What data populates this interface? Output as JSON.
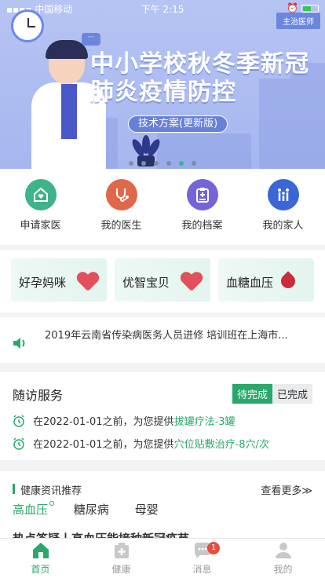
{
  "status_bar": {
    "carrier": "中国移动",
    "time": "下午 2:15"
  },
  "banner": {
    "role_badge": "主治医师",
    "title": "中小学校秋冬季新冠肺炎疫情防控",
    "button": "技术方案(更新版)",
    "dots_total": 6,
    "dots_active_index": 4
  },
  "quick_nav": [
    {
      "label": "申请家医",
      "icon": "home-heart-icon",
      "color": "#3fb389"
    },
    {
      "label": "我的医生",
      "icon": "stethoscope-icon",
      "color": "#e0674a"
    },
    {
      "label": "我的档案",
      "icon": "clipboard-icon",
      "color": "#7564d8"
    },
    {
      "label": "我的家人",
      "icon": "family-icon",
      "color": "#3a66d6"
    }
  ],
  "feature_cards": [
    {
      "label": "好孕妈咪",
      "icon": "heart-icon"
    },
    {
      "label": "优智宝贝",
      "icon": "heart-icon"
    },
    {
      "label": "血糖血压",
      "icon": "blood-drop-icon"
    }
  ],
  "notice": {
    "text": "2019年云南省传染病医务人员进修 培训班在上海市..."
  },
  "followup": {
    "title": "随访服务",
    "tabs": [
      "待完成",
      "已完成"
    ],
    "active_tab": 0,
    "items": [
      {
        "prefix": "在2022-01-01之前，为您提供",
        "highlight": "拔罐疗法-3罐"
      },
      {
        "prefix": "在2022-01-01之前，为您提供",
        "highlight": "穴位贴敷治疗-8穴/次"
      }
    ]
  },
  "news": {
    "title": "健康资讯推荐",
    "more": "查看更多≫",
    "tabs": [
      "高血压",
      "糖尿病",
      "母婴"
    ],
    "active_tab": 0,
    "article": "热点答疑丨高血压能接种新冠疫苗"
  },
  "tabbar": {
    "items": [
      "首页",
      "健康",
      "消息",
      "我的"
    ],
    "active": 0,
    "message_badge": "1"
  },
  "colors": {
    "accent": "#2aa86b",
    "banner": "#b6c4f3"
  }
}
